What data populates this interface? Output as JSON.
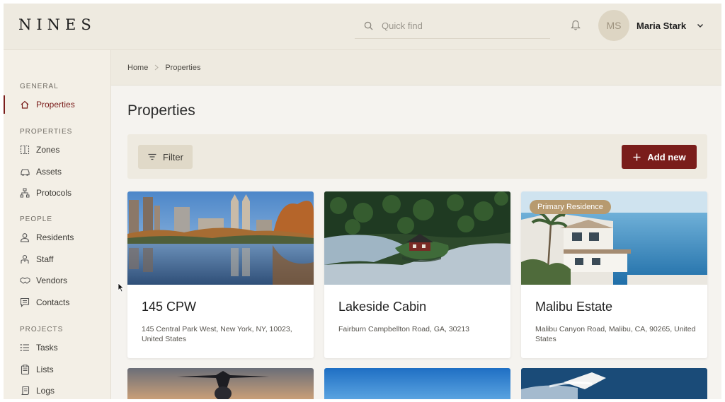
{
  "header": {
    "logo": "NINES",
    "search_placeholder": "Quick find",
    "user_initials": "MS",
    "user_name": "Maria Stark"
  },
  "sidebar": {
    "sections": [
      {
        "label": "GENERAL",
        "items": [
          {
            "label": "Properties",
            "icon": "house-icon",
            "active": true
          }
        ]
      },
      {
        "label": "PROPERTIES",
        "items": [
          {
            "label": "Zones",
            "icon": "zones-icon"
          },
          {
            "label": "Assets",
            "icon": "car-icon"
          },
          {
            "label": "Protocols",
            "icon": "hierarchy-icon"
          }
        ]
      },
      {
        "label": "PEOPLE",
        "items": [
          {
            "label": "Residents",
            "icon": "person-icon"
          },
          {
            "label": "Staff",
            "icon": "staff-icon"
          },
          {
            "label": "Vendors",
            "icon": "handshake-icon"
          },
          {
            "label": "Contacts",
            "icon": "chat-icon"
          }
        ]
      },
      {
        "label": "PROJECTS",
        "items": [
          {
            "label": "Tasks",
            "icon": "list-icon"
          },
          {
            "label": "Lists",
            "icon": "clipboard-icon"
          },
          {
            "label": "Logs",
            "icon": "log-icon"
          }
        ]
      }
    ]
  },
  "breadcrumb": {
    "home": "Home",
    "current": "Properties"
  },
  "main": {
    "title": "Properties",
    "filter_label": "Filter",
    "add_label": "Add new"
  },
  "cards": [
    {
      "title": "145 CPW",
      "address": "145 Central Park West, New York, NY, 10023, United States",
      "badge": ""
    },
    {
      "title": "Lakeside Cabin",
      "address": "Fairburn Campbellton Road, GA, 30213",
      "badge": ""
    },
    {
      "title": "Malibu Estate",
      "address": "Malibu Canyon Road, Malibu, CA, 90265, United States",
      "badge": "Primary Residence"
    }
  ],
  "colors": {
    "accent": "#7a1d1b",
    "header_bg": "#eeeae0",
    "sidebar_bg": "#f3efe6",
    "badge_bg": "#b79a6f"
  }
}
